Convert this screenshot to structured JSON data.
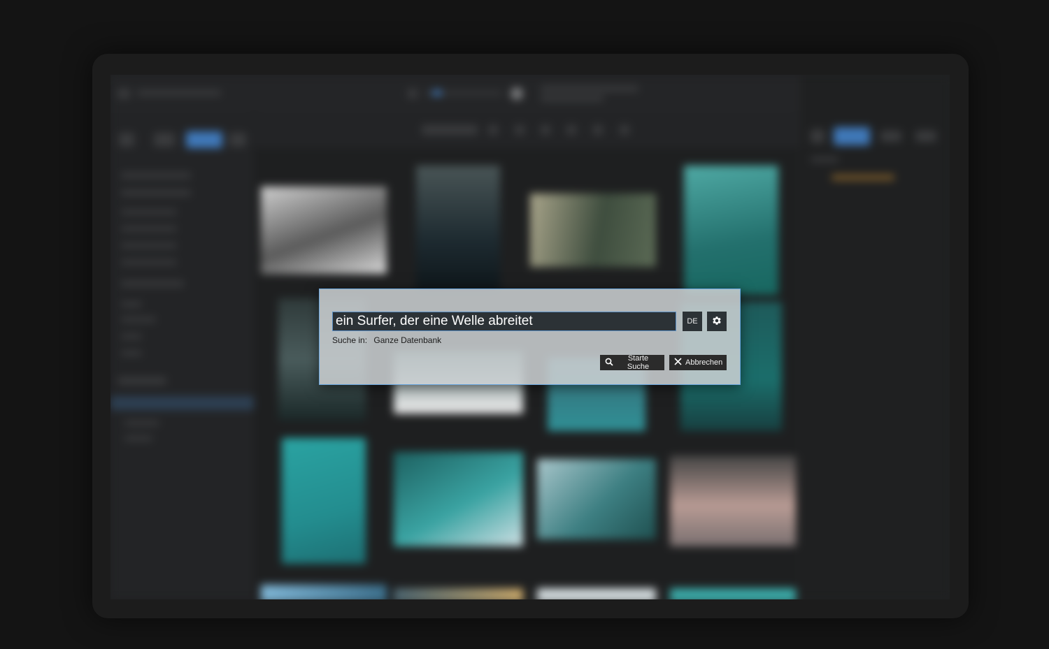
{
  "dialog": {
    "query_value": "ein Surfer, der eine Welle abreitet",
    "language_label": "DE",
    "scope_label": "Suche in:",
    "scope_value": "Ganze Datenbank",
    "start_label": "Starte Suche",
    "cancel_label": "Abbrechen"
  },
  "icons": {
    "settings": "gear-icon",
    "start": "search-icon",
    "cancel": "close-icon"
  },
  "colors": {
    "accent": "#3f78b8",
    "dialog_bg": "#cdd2d4",
    "button_bg": "#2b2b2b"
  }
}
